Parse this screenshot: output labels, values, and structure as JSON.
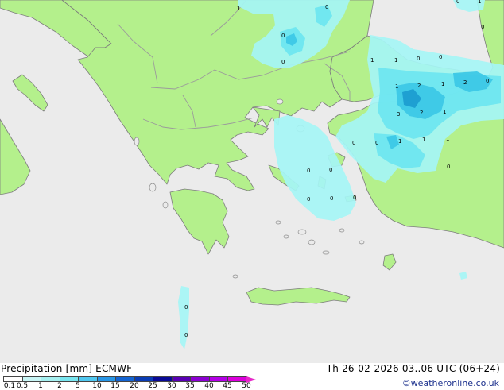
{
  "map": {
    "labels": [
      "1",
      "0",
      "0",
      "0",
      "0",
      "1",
      "0",
      "1",
      "1",
      "0",
      "0",
      "1",
      "2",
      "1",
      "2",
      "0",
      "3",
      "2",
      "1",
      "0",
      "1",
      "1",
      "1",
      "0",
      "0",
      "0",
      "0",
      "0",
      "0",
      "0",
      "0",
      "0"
    ],
    "colors": {
      "land": "#b4f08c",
      "sea": "#ebebeb",
      "rain_light": "#a5f5f5",
      "rain_mid": "#6ee6f0",
      "rain_heavy": "#3cc8e6"
    }
  },
  "footer": {
    "title": "Precipitation [mm] ECMWF",
    "valid_time": "Th 26-02-2026 03..06 UTC (06+24)",
    "copyright": "©weatheronline.co.uk",
    "scale": {
      "colors": [
        "#fefefe",
        "#c8f5f5",
        "#a5f0f0",
        "#78e6f0",
        "#50c8f0",
        "#2896e6",
        "#1464d2",
        "#0a3cb4",
        "#0a0a96",
        "#5a00b4",
        "#8c00d2",
        "#b400e6",
        "#dc00dc",
        "#e628c8"
      ],
      "ticks": [
        "0.1",
        "0.5",
        "1",
        "2",
        "5",
        "10",
        "15",
        "20",
        "25",
        "30",
        "35",
        "40",
        "45",
        "50"
      ]
    }
  }
}
